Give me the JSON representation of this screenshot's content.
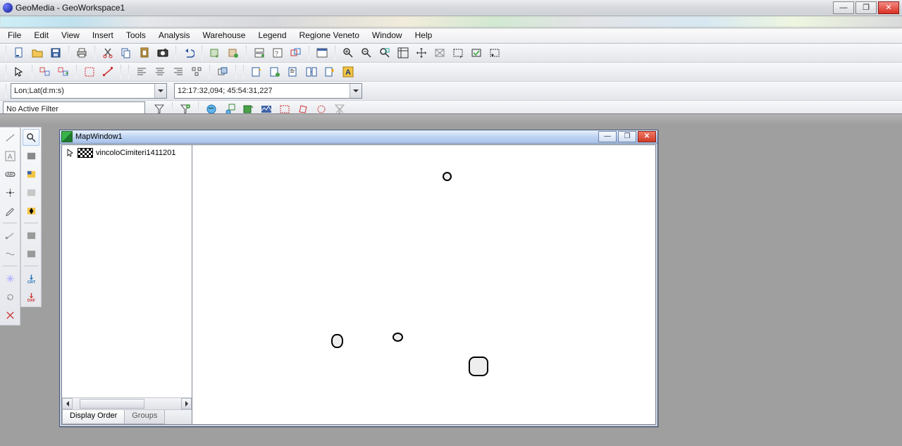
{
  "app": {
    "title": "GeoMedia - GeoWorkspace1"
  },
  "menu": {
    "file": "File",
    "edit": "Edit",
    "view": "View",
    "insert": "Insert",
    "tools": "Tools",
    "analysis": "Analysis",
    "warehouse": "Warehouse",
    "legend": "Legend",
    "regione": "Regione Veneto",
    "window": "Window",
    "help": "Help"
  },
  "coord": {
    "format": "Lon;Lat(d:m:s)",
    "value": "12:17:32,094;  45:54:31,227"
  },
  "filter": {
    "active": "No Active Filter"
  },
  "child": {
    "title": "MapWindow1",
    "layer0": "vincoloCimiteri1411201"
  },
  "legend_tabs": {
    "display_order": "Display Order",
    "groups": "Groups"
  },
  "icons": {}
}
